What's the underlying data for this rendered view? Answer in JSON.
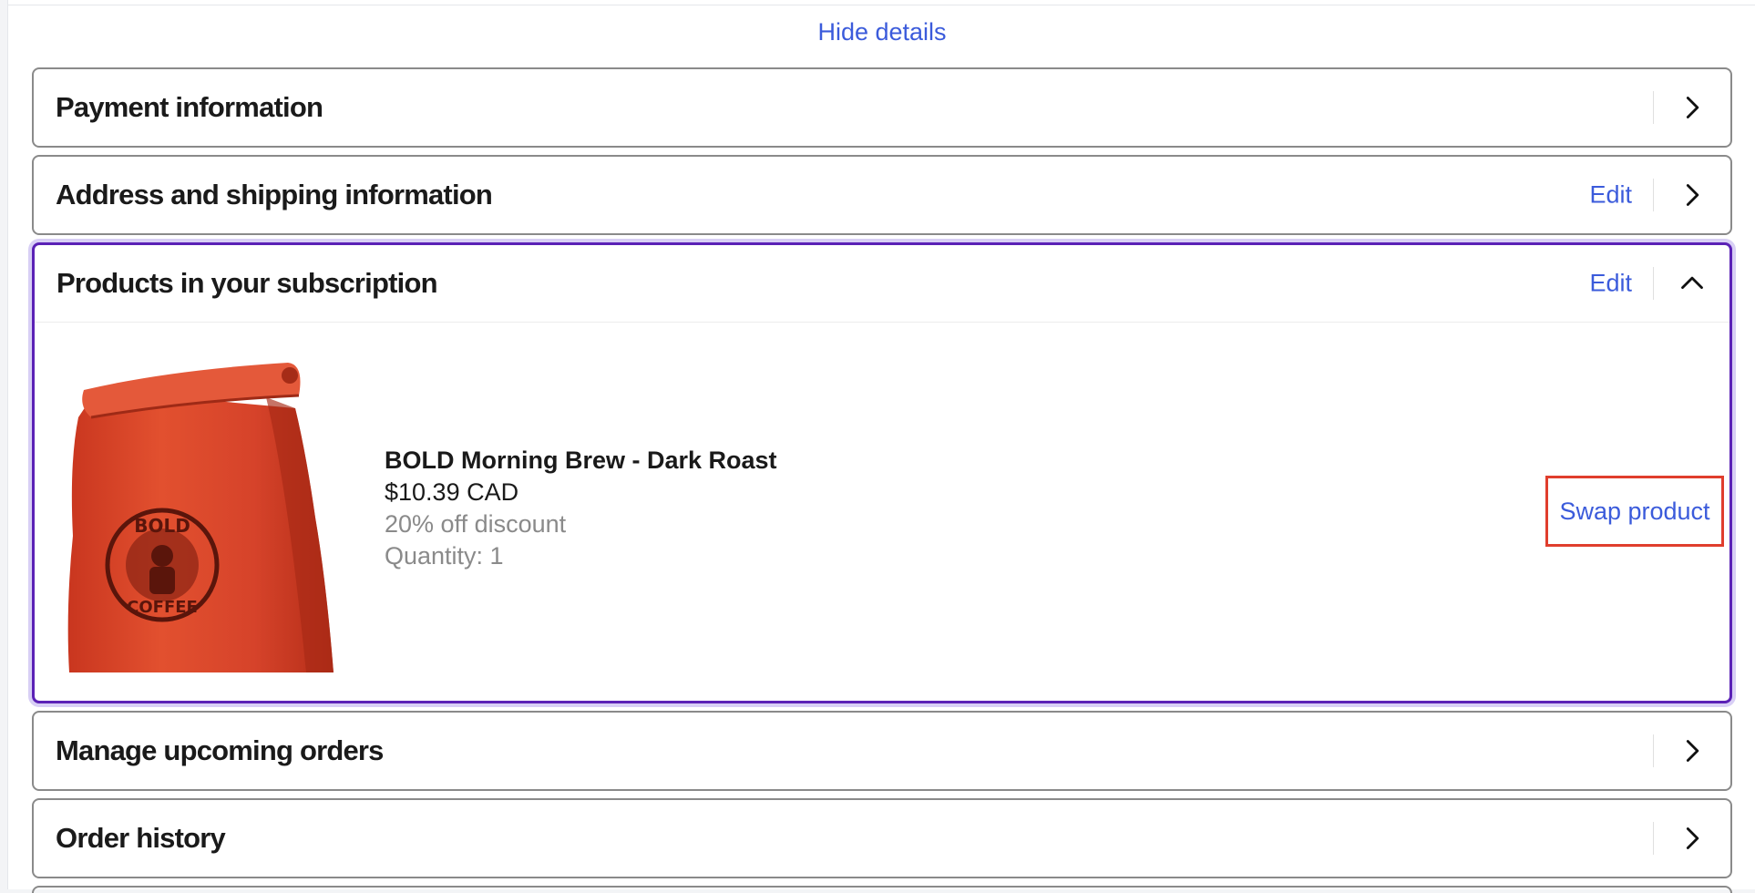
{
  "hide_details_label": "Hide details",
  "panels": {
    "payment": {
      "title": "Payment information"
    },
    "address": {
      "title": "Address and shipping information",
      "edit_label": "Edit"
    },
    "products": {
      "title": "Products in your subscription",
      "edit_label": "Edit",
      "product": {
        "name": "BOLD Morning Brew - Dark Roast",
        "price": "$10.39 CAD",
        "discount": "20% off discount",
        "quantity": "Quantity: 1",
        "image_logo_text": [
          "BOLD",
          "COFFEE"
        ],
        "swap_label": "Swap product"
      }
    },
    "upcoming": {
      "title": "Manage upcoming orders"
    },
    "history": {
      "title": "Order history"
    }
  },
  "colors": {
    "link": "#3b5bdb",
    "accent_border": "#5b21b6",
    "highlight": "#e03e2d",
    "bag": "#e0452a"
  },
  "icons": {
    "collapsed": "chevron-right-icon",
    "expanded": "chevron-up-icon"
  }
}
